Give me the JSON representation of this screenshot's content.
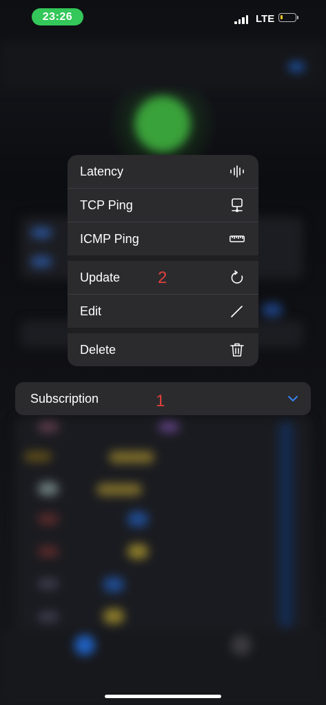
{
  "status_bar": {
    "time": "23:26",
    "network": "LTE"
  },
  "menu": {
    "items": [
      {
        "label": "Latency",
        "icon": "waveform-icon"
      },
      {
        "label": "TCP Ping",
        "icon": "desktop-network-icon"
      },
      {
        "label": "ICMP Ping",
        "icon": "ruler-icon"
      },
      {
        "label": "Update",
        "icon": "refresh-icon"
      },
      {
        "label": "Edit",
        "icon": "pencil-icon"
      },
      {
        "label": "Delete",
        "icon": "trash-icon"
      }
    ]
  },
  "subscription": {
    "label": "Subscription"
  },
  "annotations": {
    "first": "1",
    "second": "2"
  },
  "colors": {
    "accent": "#3b82f6",
    "annotation": "#e0403a",
    "time_pill": "#34c759",
    "menu_bg": "#2b2b2e"
  }
}
